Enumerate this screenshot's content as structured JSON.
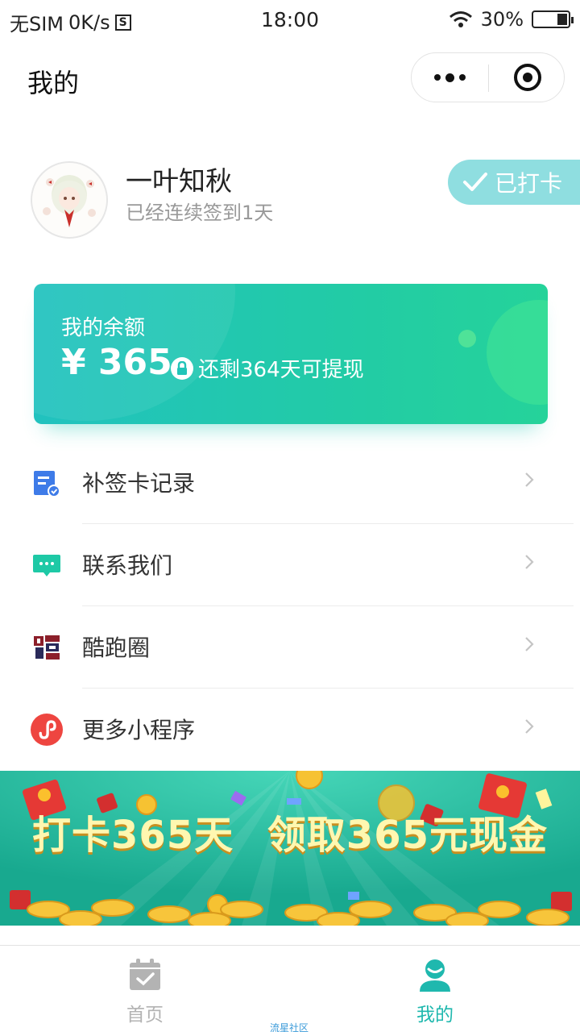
{
  "status_bar": {
    "carrier": "无SIM",
    "speed": "0K/s",
    "time": "18:00",
    "battery": "30%",
    "battery_level": 0.3
  },
  "header": {
    "title": "我的"
  },
  "profile": {
    "name": "一叶知秋",
    "streak": "已经连续签到1天",
    "checked_label": "已打卡"
  },
  "balance": {
    "label": "我的余额",
    "amount": "¥ 365",
    "note": "还剩364天可提现"
  },
  "menu": [
    {
      "label": "补签卡记录",
      "icon": "document-icon"
    },
    {
      "label": "联系我们",
      "icon": "chat-icon"
    },
    {
      "label": "酷跑圈",
      "icon": "run-logo-icon"
    },
    {
      "label": "更多小程序",
      "icon": "miniprogram-icon"
    }
  ],
  "banner": {
    "text": "打卡365天 领取365元现金"
  },
  "tabbar": [
    {
      "label": "首页",
      "active": false
    },
    {
      "label": "我的",
      "active": true
    }
  ],
  "watermark": "流星社区",
  "colors": {
    "accent": "#22c7b0",
    "active_tab": "#1fb8ae",
    "inactive_tab": "#b3b3b3"
  }
}
